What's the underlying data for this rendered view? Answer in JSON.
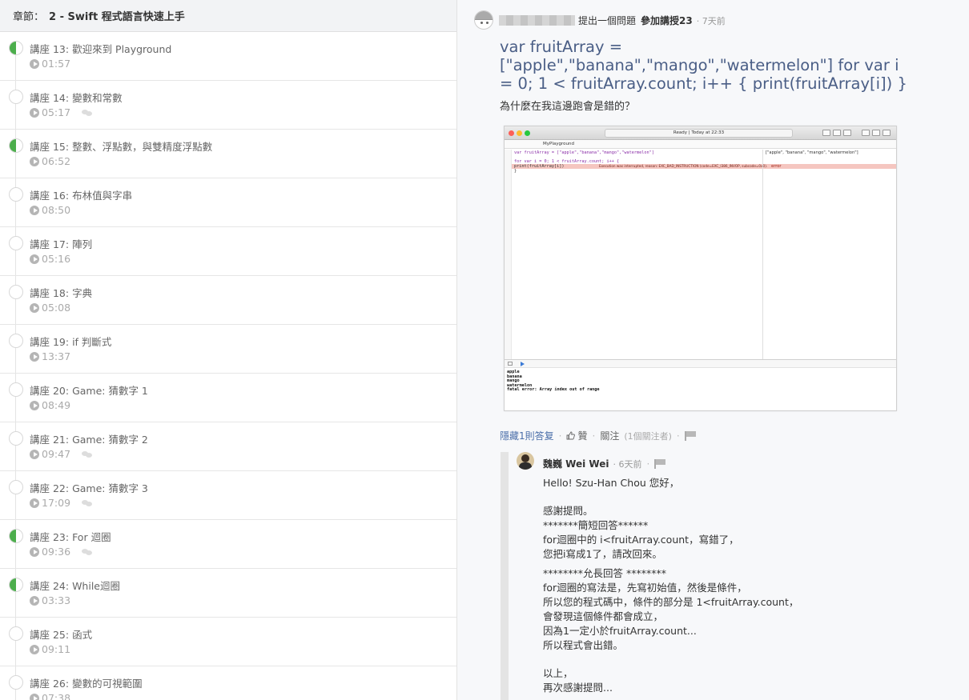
{
  "section": {
    "label": "章節：",
    "title": "2 - Swift 程式語言快速上手"
  },
  "lectures": [
    {
      "title": "講座 13: 歡迎來到 Playground",
      "duration": "01:57",
      "progress": 0.5,
      "has_comments": false
    },
    {
      "title": "講座 14: 變數和常數",
      "duration": "05:17",
      "progress": 0,
      "has_comments": true
    },
    {
      "title": "講座 15: 整數、浮點數，與雙精度浮點數",
      "duration": "06:52",
      "progress": 0.5,
      "has_comments": false
    },
    {
      "title": "講座 16: 布林值與字串",
      "duration": "08:50",
      "progress": 0,
      "has_comments": false
    },
    {
      "title": "講座 17: 陣列",
      "duration": "05:16",
      "progress": 0,
      "has_comments": false
    },
    {
      "title": "講座 18: 字典",
      "duration": "05:08",
      "progress": 0,
      "has_comments": false
    },
    {
      "title": "講座 19: if 判斷式",
      "duration": "13:37",
      "progress": 0,
      "has_comments": false
    },
    {
      "title": "講座 20: Game: 猜數字 1",
      "duration": "08:49",
      "progress": 0,
      "has_comments": false
    },
    {
      "title": "講座 21: Game: 猜數字 2",
      "duration": "09:47",
      "progress": 0,
      "has_comments": true
    },
    {
      "title": "講座 22: Game: 猜數字 3",
      "duration": "17:09",
      "progress": 0,
      "has_comments": true
    },
    {
      "title": "講座 23: For 迴圈",
      "duration": "09:36",
      "progress": 0.5,
      "has_comments": true
    },
    {
      "title": "講座 24: While迴圈",
      "duration": "03:33",
      "progress": 0.5,
      "has_comments": false
    },
    {
      "title": "講座 25: 函式",
      "duration": "09:11",
      "progress": 0,
      "has_comments": false
    },
    {
      "title": "講座 26: 變數的可視範圍",
      "duration": "07:38",
      "progress": 0,
      "has_comments": false
    }
  ],
  "question": {
    "action_text": "提出一個問題",
    "course": "參加講授23",
    "time": "· 7天前",
    "title": "var fruitArray = [\"apple\",\"banana\",\"mango\",\"watermelon\"] for var i = 0; 1 < fruitArray.count; i++ { print(fruitArray[i]) }",
    "body": "為什麼在我這邊跑會是錯的？"
  },
  "screenshot": {
    "status": "Ready  |  Today at 22:33",
    "file": "MyPlayground",
    "code_lines": [
      "var fruitArray = [\"apple\",\"banana\",\"mango\",\"watermelon\"]",
      "",
      "for var i = 0; 1 < fruitArray.count; i++ {",
      "    print(fruitArray[i])",
      "}"
    ],
    "error_message": "Execution was interrupted, reason: EXC_BAD_INSTRUCTION (code=EXC_I386_INVOP, subcode=0x0).",
    "result_line": "[\"apple\", \"banana\", \"mango\", \"watermelon\"]",
    "result_error": "error",
    "console_output": "apple\nbanana\nmango\nwatermelon\nfatal error: Array index out of range"
  },
  "actions": {
    "hide_replies": "隱藏1則答复",
    "like": "贊",
    "follow": "關注",
    "followers": "(1個關注者)",
    "dot": "·"
  },
  "reply": {
    "author": "魏巍 Wei Wei",
    "time": "· 6天前",
    "dot": "·",
    "greeting": "Hello! Szu-Han Chou 您好，",
    "thanks": "感謝提問。",
    "short_heading": "*******簡短回答******",
    "short_1": "for迴圈中的 i<fruitArray.count，寫錯了，",
    "short_2": "您把i寫成1了，請改回來。",
    "long_heading": "********允長回答 ********",
    "long_1": "for迴圈的寫法是，先寫初始值，然後是條件，",
    "long_2": "所以您的程式碼中，條件的部分是 1<fruitArray.count，",
    "long_3": "會發現這個條件都會成立，",
    "long_4": "因為1一定小於fruitArray.count...",
    "long_5": "所以程式會出錯。",
    "closing_1": "以上，",
    "closing_2": "再次感謝提問..."
  }
}
